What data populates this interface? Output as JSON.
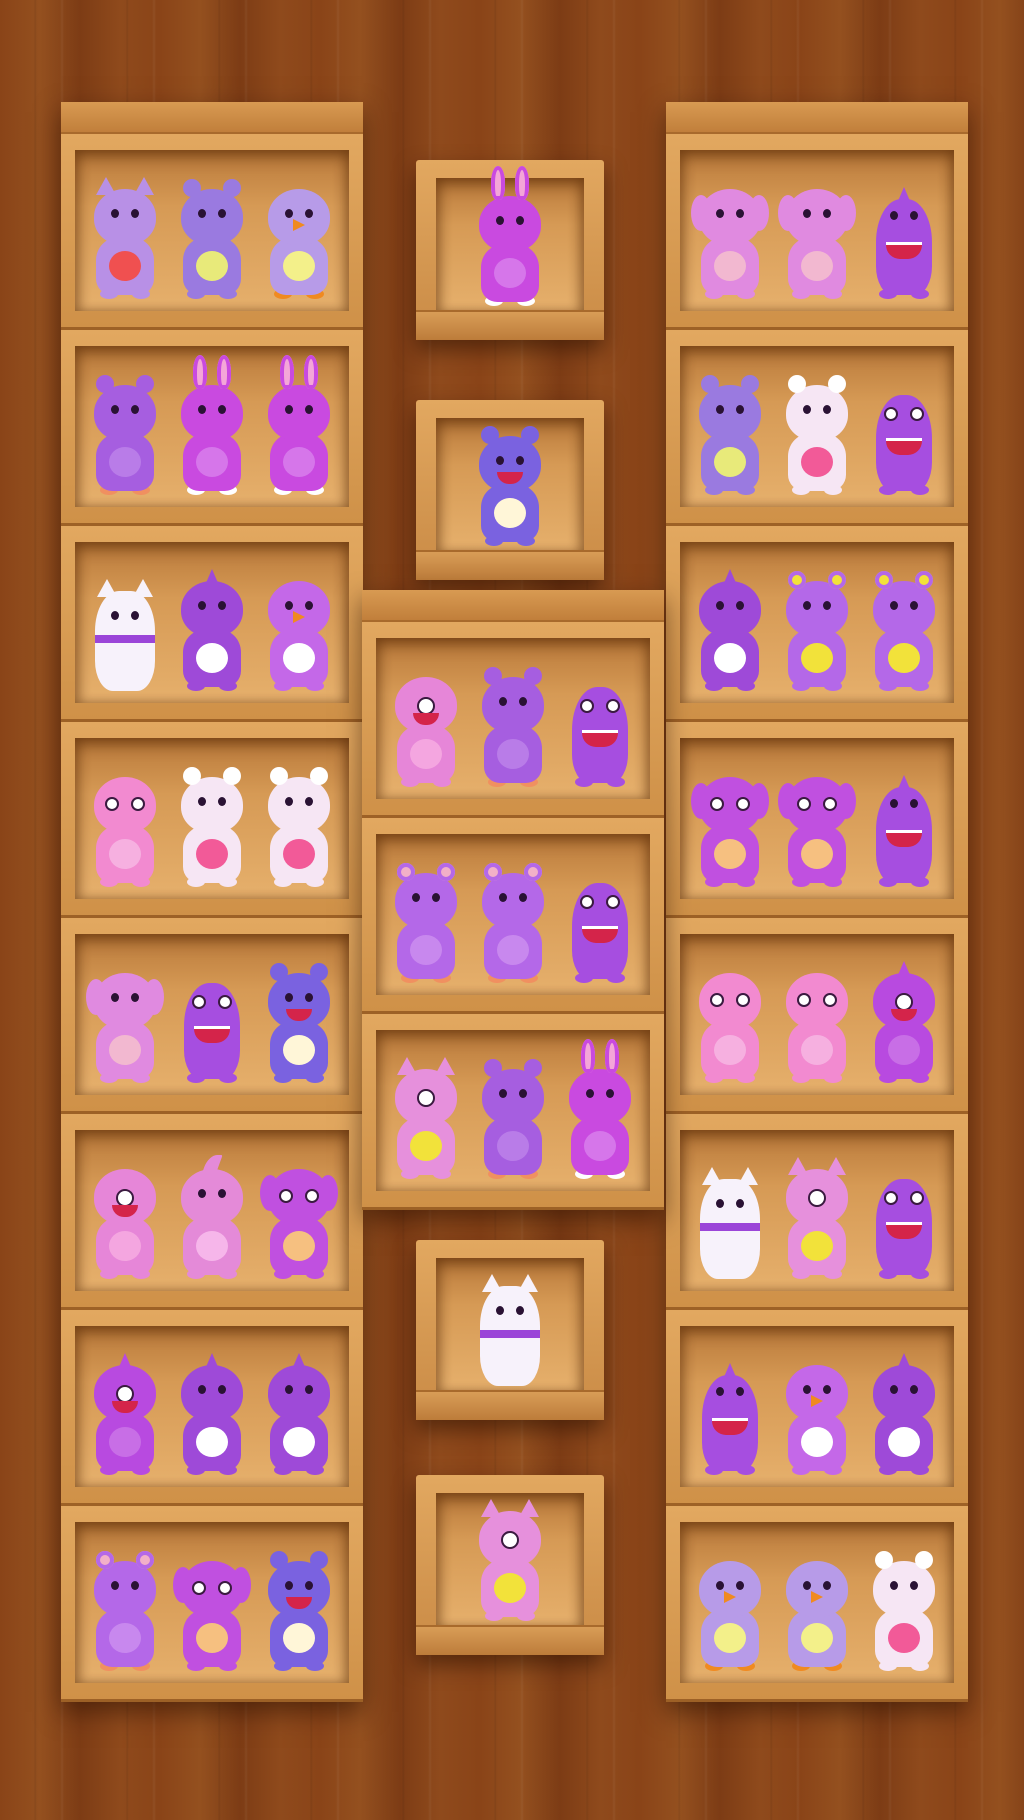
{
  "colors": {
    "background": "#8a4418",
    "shelf": "#c98a45",
    "shelf_inner": "#e2a860"
  },
  "left_shelf": [
    {
      "toys": [
        "cat-toy",
        "hippo-toy",
        "bird-toy"
      ]
    },
    {
      "toys": [
        "bear-toy",
        "bunny-toy",
        "bunny-toy"
      ]
    },
    {
      "toys": [
        "lucky-cat-toy",
        "dino-toy",
        "penguin-toy"
      ]
    },
    {
      "toys": [
        "butterfly-toy",
        "cow-toy",
        "cow-toy"
      ]
    },
    {
      "toys": [
        "puppy-toy",
        "monster-toy",
        "hippo-mouth-toy"
      ]
    },
    {
      "toys": [
        "one-eye-monster-toy",
        "shark-toy",
        "bunny-monster-toy"
      ]
    },
    {
      "toys": [
        "cyclops-toy",
        "dino-toy",
        "dino-toy"
      ]
    },
    {
      "toys": [
        "teddy-bear-toy",
        "bunny-monster-toy",
        "hippo-mouth-toy"
      ]
    }
  ],
  "right_shelf": [
    {
      "toys": [
        "puppy-toy",
        "puppy-toy",
        "fang-monster-toy"
      ]
    },
    {
      "toys": [
        "hippo-toy",
        "cow-toy",
        "monster-toy"
      ]
    },
    {
      "toys": [
        "dino-toy",
        "yellow-bear-toy",
        "yellow-bear-toy"
      ]
    },
    {
      "toys": [
        "bunny-monster-toy",
        "bunny-monster-toy",
        "fang-monster-toy"
      ]
    },
    {
      "toys": [
        "butterfly-toy",
        "butterfly-toy",
        "cyclops-toy"
      ]
    },
    {
      "toys": [
        "lucky-cat-toy",
        "horned-cyclops-toy",
        "monster-toy"
      ]
    },
    {
      "toys": [
        "fang-monster-toy",
        "penguin-toy",
        "dino-toy"
      ]
    },
    {
      "toys": [
        "bird-toy",
        "bird-toy",
        "cow-toy"
      ]
    }
  ],
  "middle_singles_top": [
    {
      "toys": [
        "bunny-toy"
      ]
    },
    {
      "toys": [
        "hippo-mouth-toy"
      ]
    }
  ],
  "middle_shelf": [
    {
      "toys": [
        "one-eye-monster-toy",
        "bear-toy",
        "monster-toy"
      ]
    },
    {
      "toys": [
        "teddy-bear-toy",
        "teddy-bear-toy",
        "monster-toy"
      ]
    },
    {
      "toys": [
        "horned-cyclops-toy",
        "bear-toy",
        "bunny-toy"
      ]
    }
  ],
  "middle_singles_bottom": [
    {
      "toys": [
        "lucky-cat-toy"
      ]
    },
    {
      "toys": [
        "horned-cyclops-toy"
      ]
    }
  ]
}
